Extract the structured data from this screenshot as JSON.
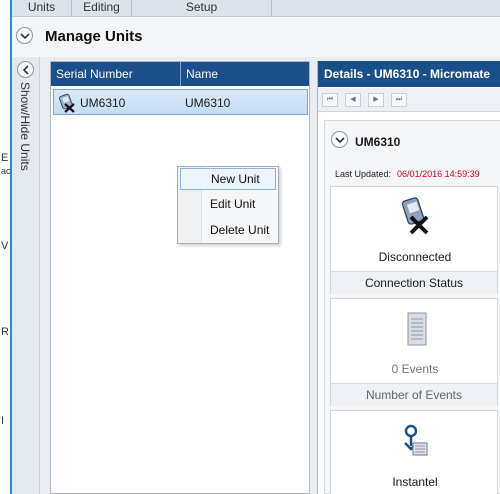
{
  "edge": {
    "letters": [
      "E",
      "ac",
      "V",
      "R",
      "I"
    ]
  },
  "tabs": [
    {
      "label": "Units",
      "width": 60
    },
    {
      "label": "Editing",
      "width": 60
    },
    {
      "label": "Setup",
      "width": 140
    }
  ],
  "page": {
    "title": "Manage Units"
  },
  "side_strip": {
    "label": "Show/Hide Units"
  },
  "unit_list": {
    "columns": [
      "Serial Number",
      "Name"
    ],
    "rows": [
      {
        "serial": "UM6310",
        "name": "UM6310"
      }
    ]
  },
  "context_menu": {
    "items": [
      "New Unit",
      "Edit Unit",
      "Delete Unit"
    ],
    "highlighted": "New Unit"
  },
  "details": {
    "header": "Details - UM6310 - Micromate",
    "unit_title": "UM6310",
    "last_updated_label": "Last Updated:",
    "last_updated_value": "06/01/2016 14:59:39",
    "cards": [
      {
        "icon": "disconnected-device-icon",
        "value": "Disconnected",
        "label": "Connection Status"
      },
      {
        "icon": "events-document-icon",
        "value": "0 Events",
        "label": "Number of Events"
      },
      {
        "icon": "instantel-logo-icon",
        "value": "Instantel",
        "label": ""
      }
    ]
  },
  "colors": {
    "header_blue": "#1b4f8a",
    "accent_blue": "#1f8fd0",
    "timestamp_red": "#d0021b"
  }
}
